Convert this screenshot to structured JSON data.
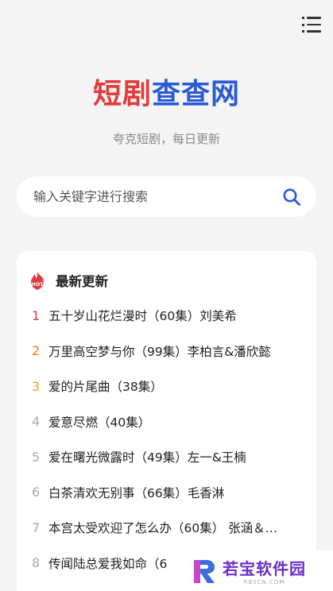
{
  "header": {
    "logo_text_part1": "短剧",
    "logo_text_part2": "查查网",
    "tagline": "夸克短剧，每日更新"
  },
  "search": {
    "placeholder": "输入关键字进行搜索"
  },
  "latest": {
    "title": "最新更新",
    "hot_badge": "HOT",
    "items": [
      {
        "rank": "1",
        "title": "五十岁山花烂漫时（60集）刘美希"
      },
      {
        "rank": "2",
        "title": "万里高空梦与你（99集）李柏言&潘欣懿"
      },
      {
        "rank": "3",
        "title": "爱的片尾曲（38集）"
      },
      {
        "rank": "4",
        "title": "爱意尽燃（40集）"
      },
      {
        "rank": "5",
        "title": "爱在曙光微露时（49集）左一&王楠"
      },
      {
        "rank": "6",
        "title": "白茶清欢无别事（66集）毛香淋"
      },
      {
        "rank": "7",
        "title": "本宫太受欢迎了怎么办（60集） 张涵＆…"
      },
      {
        "rank": "8",
        "title": "传闻陆总爱我如命（6"
      }
    ]
  },
  "watermark": {
    "text": "若宝软件园",
    "sub": "RBSCN.COM"
  },
  "colors": {
    "logo_red": "#e23b3b",
    "logo_blue": "#2a5ad6",
    "rank1": "#e23b3b",
    "rank2": "#f07a1a",
    "rank3": "#e8a81b"
  }
}
